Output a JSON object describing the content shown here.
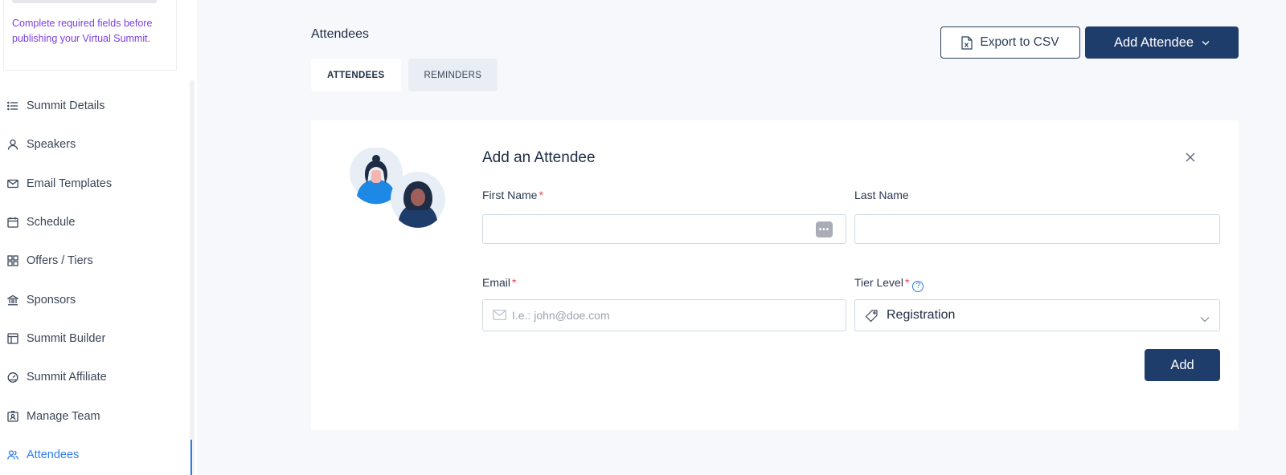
{
  "sidebar": {
    "notice": "Complete required fields before publishing your Virtual Summit.",
    "items": [
      {
        "label": "Summit Details",
        "icon": "list-icon"
      },
      {
        "label": "Speakers",
        "icon": "user-icon"
      },
      {
        "label": "Email Templates",
        "icon": "mail-icon"
      },
      {
        "label": "Schedule",
        "icon": "calendar-icon"
      },
      {
        "label": "Offers / Tiers",
        "icon": "offers-icon"
      },
      {
        "label": "Sponsors",
        "icon": "bank-icon"
      },
      {
        "label": "Summit Builder",
        "icon": "layout-icon"
      },
      {
        "label": "Summit Affiliate",
        "icon": "gauge-icon"
      },
      {
        "label": "Manage Team",
        "icon": "team-icon"
      },
      {
        "label": "Attendees",
        "icon": "attendees-icon",
        "active": true
      }
    ]
  },
  "main": {
    "title": "Attendees",
    "tabs": [
      {
        "label": "ATTENDEES",
        "active": true
      },
      {
        "label": "REMINDERS",
        "active": false
      }
    ],
    "export_label": "Export to CSV",
    "add_attendee_label": "Add Attendee"
  },
  "form": {
    "title": "Add an Attendee",
    "first_name_label": "First Name",
    "last_name_label": "Last Name",
    "email_label": "Email",
    "email_placeholder": "I.e.: john@doe.com",
    "tier_label": "Tier Level",
    "tier_value": "Registration",
    "required_mark": "*",
    "help_mark": "?",
    "add_label": "Add"
  },
  "colors": {
    "accent": "#2e7be8",
    "primary_button": "#1f3d6b",
    "notice_text": "#7b3fe4",
    "required": "#e5484d"
  }
}
